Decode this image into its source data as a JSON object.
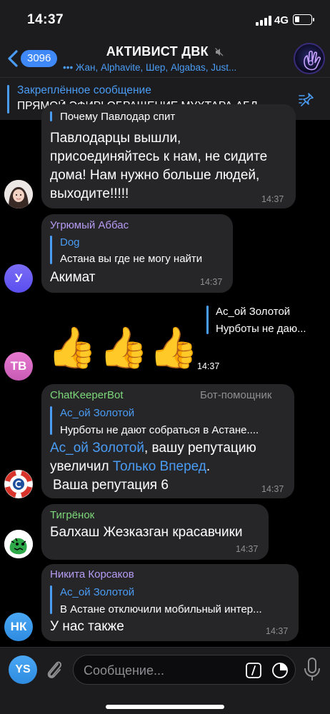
{
  "status_bar": {
    "time": "14:37",
    "network": "4G",
    "battery_level": 0.3
  },
  "header": {
    "back_count": "3096",
    "title": "АКТИВИСТ ДВК",
    "subtitle": "••• Жан, Alphavite, Шер, Algabas, Just..."
  },
  "pinned": {
    "title": "Закреплённое сообщение",
    "text": "ПРЯМОЙ ЭФИР! ОБРАЩЕНИЕ МУХТАРА АБЛ..."
  },
  "messages": [
    {
      "reply_text": "Почему Павлодар спит",
      "lines": [
        "Павлодарцы вышли,",
        "присоединяйтесь к нам, не сидите",
        "дома! Нам нужно больше людей,",
        "выходите!!!!!"
      ],
      "time": "14:37"
    },
    {
      "sender": "Угрюмый Аббас",
      "reply_name": "Dog",
      "reply_text": "Астана вы где не могу найти",
      "text": "Акимат",
      "time": "14:37",
      "avatar_initials": "У"
    },
    {
      "reply_name": "Ас_ой Золотой",
      "reply_text": "Нурботы не даю...",
      "emoji": [
        "👍",
        "👍",
        "👍"
      ],
      "time": "14:37",
      "avatar_initials": "ТВ"
    },
    {
      "sender": "ChatKeeperBot",
      "role": "Бот-помощник",
      "reply_name": "Ас_ой Золотой",
      "reply_text": "Нурботы не дают собраться в Астане....",
      "mention_1": "Ас_ой Золотой",
      "text_1": ", вашу репутацию",
      "text_2": "увеличил ",
      "mention_2": "Только Вперед",
      "text_3": ".",
      "text_4": "Ваша репутация 6",
      "time": "14:37"
    },
    {
      "sender": "Тигрёнок",
      "text": "Балхаш Жезказган красавчики",
      "time": "14:37"
    },
    {
      "sender": "Никита Корсаков",
      "reply_name": "Ас_ой Золотой",
      "reply_text": "В Астане отключили мобильный интер...",
      "text": "У нас также",
      "time": "14:37",
      "avatar_initials": "НК"
    }
  ],
  "input": {
    "avatar_initials": "YS",
    "placeholder": "Сообщение..."
  },
  "colors": {
    "accent": "#4a9cf5",
    "bubble": "#262628",
    "sender_name": "#b79cf5",
    "bot_name": "#7dd87a"
  }
}
